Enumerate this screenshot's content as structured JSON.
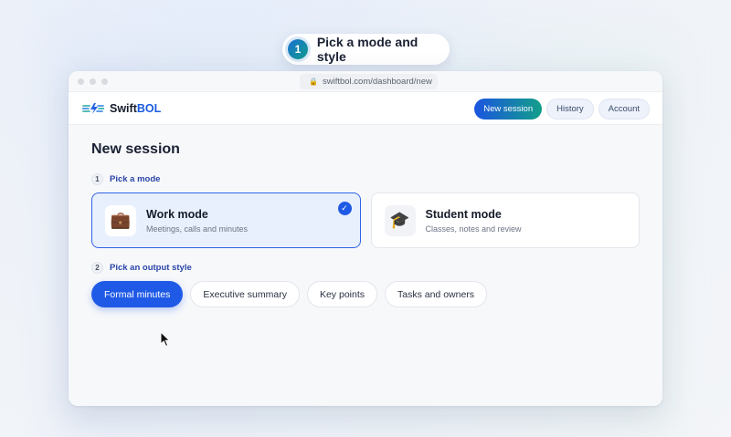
{
  "step": {
    "number": "1",
    "label": "Pick a mode and style"
  },
  "browser": {
    "url": "swiftbol.com/dashboard/new"
  },
  "header": {
    "brand_main": "Swift",
    "brand_accent": "BOL",
    "nav": [
      {
        "label": "New session"
      },
      {
        "label": "History"
      },
      {
        "label": "Account"
      }
    ]
  },
  "main": {
    "title": "New session",
    "mode_section": {
      "number": "1",
      "label": "Pick a mode"
    },
    "modes": [
      {
        "title": "Work mode",
        "subtitle": "Meetings, calls and minutes",
        "icon": "briefcase-icon",
        "selected": true
      },
      {
        "title": "Student mode",
        "subtitle": "Classes, notes and review",
        "icon": "graduation-cap-icon",
        "selected": false
      }
    ],
    "style_section": {
      "number": "2",
      "label": "Pick an output style"
    },
    "styles": [
      {
        "label": "Formal minutes",
        "active": true
      },
      {
        "label": "Executive summary",
        "active": false
      },
      {
        "label": "Key points",
        "active": false
      },
      {
        "label": "Tasks and owners",
        "active": false
      }
    ]
  },
  "colors": {
    "primary": "#1f5ae6",
    "accent_green": "#129e8a"
  }
}
